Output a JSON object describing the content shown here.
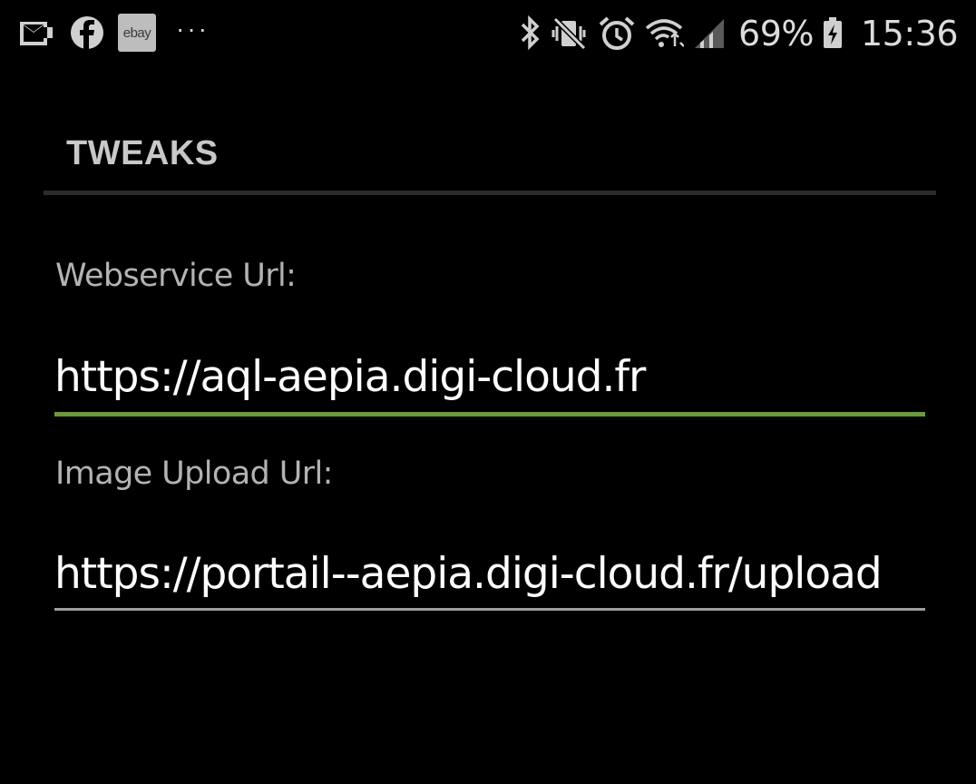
{
  "status_bar": {
    "left_icons": [
      "email-icon",
      "facebook-icon",
      "ebay-icon",
      "more-notifications-icon"
    ],
    "ebay_text": "ebay",
    "more_text": "···",
    "right_icons": [
      "bluetooth-icon",
      "vibrate-icon",
      "alarm-icon",
      "wifi-icon",
      "signal-icon",
      "battery-icon"
    ],
    "battery_percent": "69%",
    "time": "15:36"
  },
  "section": {
    "title": "TWEAKS"
  },
  "fields": {
    "webservice_label": "Webservice Url:",
    "webservice_value": "https://aql-aepia.digi-cloud.fr",
    "image_upload_label": "Image Upload Url:",
    "image_upload_value": "https://portail--aepia.digi-cloud.fr/upload"
  },
  "colors": {
    "background": "#000000",
    "accent_underline": "#6b9a3a",
    "inactive_underline": "#9e9e9e",
    "label": "#b3b3b3",
    "header": "#c8c8c8"
  }
}
